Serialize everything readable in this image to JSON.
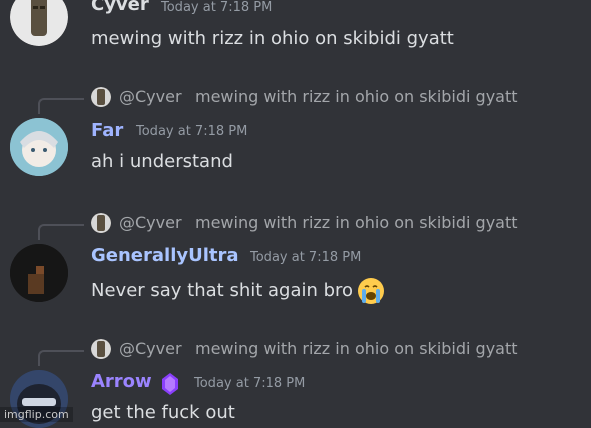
{
  "messages": [
    {
      "username": "Cyver",
      "username_color": "#dbdee1",
      "timestamp": "Today at 7:18 PM",
      "content": "mewing with rizz in ohio on skibidi gyatt"
    },
    {
      "reply": {
        "name": "@Cyver",
        "text": "mewing with rizz in ohio on skibidi gyatt"
      },
      "username": "Far",
      "username_color": "#9fb4ff",
      "timestamp": "Today at 7:18 PM",
      "content": "ah i understand"
    },
    {
      "reply": {
        "name": "@Cyver",
        "text": "mewing with rizz in ohio on skibidi gyatt"
      },
      "username": "GenerallyUltra",
      "username_color": "#a9c4ff",
      "timestamp": "Today at 7:18 PM",
      "content": "Never say that shit again bro",
      "emoji": "loudly-crying-face-icon"
    },
    {
      "reply": {
        "name": "@Cyver",
        "text": "mewing with rizz in ohio on skibidi gyatt"
      },
      "username": "Arrow",
      "username_color": "#9b84ff",
      "badge": "purple-gem-icon",
      "timestamp": "Today at 7:18 PM",
      "content": "get the fuck out"
    }
  ],
  "watermark": "imgflip.com"
}
